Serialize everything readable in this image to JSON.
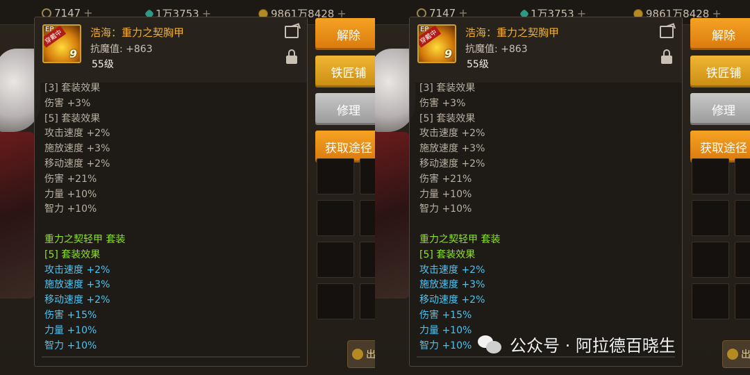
{
  "currency": {
    "c1": "7147",
    "c2": "1万3753",
    "c3": "9861万8428",
    "plus": "+"
  },
  "buttons": {
    "remove": "解除",
    "blacksmith": "铁匠铺",
    "repair": "修理",
    "obtain": "获取途径",
    "coin_partial": "出"
  },
  "item": {
    "name": "浩海：重力之契胸甲",
    "stat": "抗魔值: +863",
    "level": "55级",
    "icon_tag": "穿戴中",
    "icon_num": "9",
    "icon_ep": "EP"
  },
  "lines": [
    {
      "t": "[3] 套装效果",
      "c": "gray"
    },
    {
      "t": "伤害 +3%",
      "c": "gray"
    },
    {
      "t": "[5] 套装效果",
      "c": "gray"
    },
    {
      "t": "攻击速度 +2%",
      "c": "gray"
    },
    {
      "t": "施放速度 +3%",
      "c": "gray"
    },
    {
      "t": "移动速度 +2%",
      "c": "gray"
    },
    {
      "t": "伤害 +21%",
      "c": "gray"
    },
    {
      "t": "力量 +10%",
      "c": "gray"
    },
    {
      "t": "智力 +10%",
      "c": "gray"
    },
    {
      "t": "",
      "c": "blank"
    },
    {
      "t": "重力之契轻甲 套装",
      "c": "green"
    },
    {
      "t": "[5] 套装效果",
      "c": "green"
    },
    {
      "t": "攻击速度 +2%",
      "c": "blue"
    },
    {
      "t": "施放速度 +3%",
      "c": "blue"
    },
    {
      "t": "移动速度 +2%",
      "c": "blue"
    },
    {
      "t": "伤害 +15%",
      "c": "blue"
    },
    {
      "t": "力量 +10%",
      "c": "blue"
    },
    {
      "t": "智力 +10%",
      "c": "blue"
    }
  ],
  "watermark": {
    "text": "公众号 · 阿拉德百晓生"
  }
}
